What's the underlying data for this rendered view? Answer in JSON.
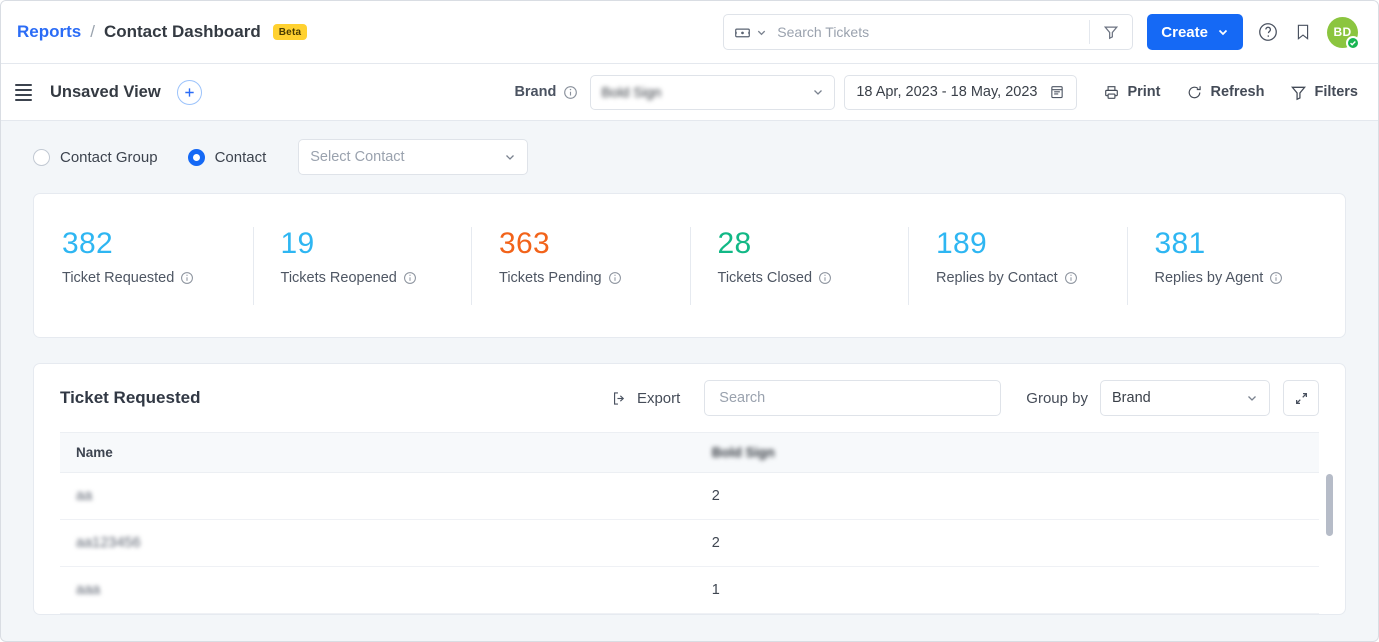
{
  "header": {
    "breadcrumb": {
      "root": "Reports",
      "separator": "/",
      "current": "Contact Dashboard",
      "badge": "Beta"
    },
    "search": {
      "placeholder": "Search Tickets",
      "value": "",
      "type_icon": "ticket-icon",
      "filter_icon": "funnel-icon"
    },
    "create_button": "Create",
    "help_icon": "question-circle-icon",
    "bookmark_icon": "bookmark-icon",
    "avatar": {
      "initials": "BD",
      "color": "#8bc53f",
      "status": "verified",
      "status_color": "#18b552"
    }
  },
  "toolbar": {
    "menu_icon": "hamburger-icon",
    "view_name": "Unsaved View",
    "add_view_label": "+",
    "brand_label": "Brand",
    "brand_info_icon": "info-icon",
    "brand_value": "Bold Sign",
    "date_range": "18 Apr, 2023 - 18 May, 2023",
    "calendar_icon": "calendar-icon",
    "print": "Print",
    "refresh": "Refresh",
    "filters": "Filters"
  },
  "filters": {
    "options": [
      {
        "label": "Contact Group",
        "selected": false
      },
      {
        "label": "Contact",
        "selected": true
      }
    ],
    "contact_select_placeholder": "Select Contact",
    "contact_select_value": ""
  },
  "stats": [
    {
      "value": "382",
      "label": "Ticket Requested",
      "color": "#2eb6f2"
    },
    {
      "value": "19",
      "label": "Tickets Reopened",
      "color": "#2eb6f2"
    },
    {
      "value": "363",
      "label": "Tickets Pending",
      "color": "#f2631a"
    },
    {
      "value": "28",
      "label": "Tickets Closed",
      "color": "#12b886"
    },
    {
      "value": "189",
      "label": "Replies by Contact",
      "color": "#2eb6f2"
    },
    {
      "value": "381",
      "label": "Replies by Agent",
      "color": "#2eb6f2"
    }
  ],
  "table_panel": {
    "title": "Ticket Requested",
    "export_label": "Export",
    "export_icon": "export-icon",
    "search_placeholder": "Search",
    "search_value": "",
    "group_by_label": "Group by",
    "group_by_value": "Brand",
    "expand_icon": "expand-diagonal-icon",
    "columns": [
      "Name",
      "Bold Sign"
    ],
    "column_blurred": [
      false,
      true
    ],
    "rows": [
      {
        "name": "aa",
        "value": "2"
      },
      {
        "name": "aa123456",
        "value": "2"
      },
      {
        "name": "aaa",
        "value": "1"
      }
    ],
    "scrollbar_present": true
  }
}
